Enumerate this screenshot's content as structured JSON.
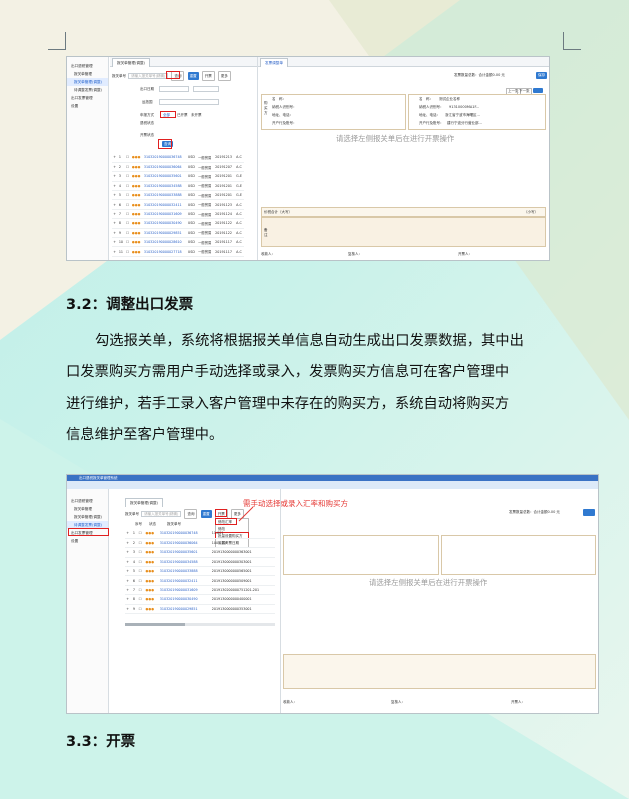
{
  "section_32": {
    "heading": "3.2：调整出口发票"
  },
  "paragraph": [
    "勾选报关单，系统将根据报关单信息自动生成出口发票数据，其中出",
    "口发票购买方需用户手动选择或录入，发票购买方信息可在客户管理中",
    "进行维护，若手工录入客户管理中未存在的购买方，系统自动将购买方",
    "信息维护至客户管理中。"
  ],
  "section_33": {
    "heading": "3.3：开票"
  },
  "screenshot1": {
    "tree": [
      "出口退税管理",
      "报关单管理",
      "报关单管理(调整)",
      "待调整发票(调整)",
      "出口发票管理",
      "设置"
    ],
    "tab_left": "报关单管理(调整)",
    "tab_right": "发票调整单",
    "search_label": "报关单号",
    "search_placeholder": "请输入报关单号(精确)",
    "buttons": [
      "查询",
      "重置",
      "开票",
      "更多"
    ],
    "form": {
      "date_label": "出口日期",
      "ship_label": "运抵国",
      "mode_label": "申报方式",
      "refund_label": "退税状态",
      "invoice_label": "开票状态"
    },
    "radio_opts": [
      "全部",
      "已开票",
      "未开票"
    ],
    "rows": [
      {
        "no": "1",
        "code": "310320190000036748",
        "cur": "USD",
        "type": "一般贸易",
        "date": "20191213",
        "flag": "A-C"
      },
      {
        "no": "2",
        "code": "310320190000036064",
        "cur": "USD",
        "type": "一般贸易",
        "date": "20191207",
        "flag": "A-C"
      },
      {
        "no": "3",
        "code": "310320190000035601",
        "cur": "USD",
        "type": "一般贸易",
        "date": "20191201",
        "flag": "G-E"
      },
      {
        "no": "4",
        "code": "310320190000034588",
        "cur": "USD",
        "type": "一般贸易",
        "date": "20191201",
        "flag": "G-E"
      },
      {
        "no": "5",
        "code": "310320190000033888",
        "cur": "USD",
        "type": "一般贸易",
        "date": "20191201",
        "flag": "G-E"
      },
      {
        "no": "6",
        "code": "310320190000032411",
        "cur": "USD",
        "type": "一般贸易",
        "date": "20191123",
        "flag": "A-C"
      },
      {
        "no": "7",
        "code": "310320190000031609",
        "cur": "USD",
        "type": "一般贸易",
        "date": "20191124",
        "flag": "A-C"
      },
      {
        "no": "8",
        "code": "310320190000030490",
        "cur": "USD",
        "type": "一般贸易",
        "date": "20191122",
        "flag": "A-C"
      },
      {
        "no": "9",
        "code": "310320190000029851",
        "cur": "USD",
        "type": "一般贸易",
        "date": "20191122",
        "flag": "A-C"
      },
      {
        "no": "10",
        "code": "310320190000028610",
        "cur": "USD",
        "type": "一般贸易",
        "date": "20191117",
        "flag": "A-C"
      },
      {
        "no": "11",
        "code": "310320190000027718",
        "cur": "USD",
        "type": "一般贸易",
        "date": "20191117",
        "flag": "A-C"
      }
    ],
    "right_title": "发票调整单",
    "right_status": "发票数量总数：合计金额0.00 元",
    "right_btn": "保存",
    "prev": "上一张",
    "next": "下一张",
    "seller": {
      "name_label": "名　称：",
      "name": "测试企业名称",
      "tax_label": "纳税人识别号：",
      "tax": "91310000MA1F...",
      "addr_label": "地址、电话：",
      "addr": "浙江省宁波市海曙区…",
      "bank_label": "开户行及账号：",
      "bank": "建行宁波分行营业部…"
    },
    "buyer": {
      "side": "购买方",
      "name_label": "名　称：",
      "tax_label": "纳税人识别号：",
      "addr_label": "地址、电话：",
      "bank_label": "开户行及账号："
    },
    "placeholder": "请选择左侧报关单后在进行开票操作",
    "total_label": "价税合计（大写）",
    "total_small": "（小写）",
    "remark_label": "备注",
    "footer": [
      "收款人：",
      "复核人：",
      "开票人："
    ]
  },
  "screenshot2": {
    "window_title": "出口退税报关单管理系统",
    "tree": [
      "出口退税管理",
      "报关单管理",
      "报关单管理(调整)",
      "待调整发票(调整)",
      "出口发票管理",
      "设置"
    ],
    "tab_left": "报关单管理(调整)",
    "search_label": "报关单号",
    "search_placeholder": "请输入报关单号(精确)",
    "buttons": [
      "查询",
      "重置",
      "开票",
      "更多"
    ],
    "columns": [
      "序号",
      "状态",
      "报关单号"
    ],
    "menu": [
      "修改汇率",
      "修改",
      "批量设置购买方",
      "设置开票日期"
    ],
    "annotation": "需手动选择或录入汇率和购买方",
    "rows": [
      {
        "no": "1",
        "code": "310320190000036748",
        "ref": "11-001"
      },
      {
        "no": "2",
        "code": "310320190000036064",
        "ref": "1001-201"
      },
      {
        "no": "3",
        "code": "310320190000035601",
        "ref": "2019130000000363001"
      },
      {
        "no": "4",
        "code": "310320190000034588",
        "ref": "2019130000000303001"
      },
      {
        "no": "5",
        "code": "310320190000033888",
        "ref": "2019130000000565001"
      },
      {
        "no": "6",
        "code": "310320190000032411",
        "ref": "2019130000000509001"
      },
      {
        "no": "7",
        "code": "310320190000031609",
        "ref": "2019130200000751201-201"
      },
      {
        "no": "8",
        "code": "310320190000030490",
        "ref": "2019130000000400001"
      },
      {
        "no": "9",
        "code": "310320190000029851",
        "ref": "2019130000000353001"
      }
    ],
    "right_status": "发票数量总数：合计金额0.00 元",
    "placeholder": "请选择左侧报关单后在进行开票操作",
    "footer": [
      "收款人：",
      "复核人：",
      "开票人："
    ]
  }
}
